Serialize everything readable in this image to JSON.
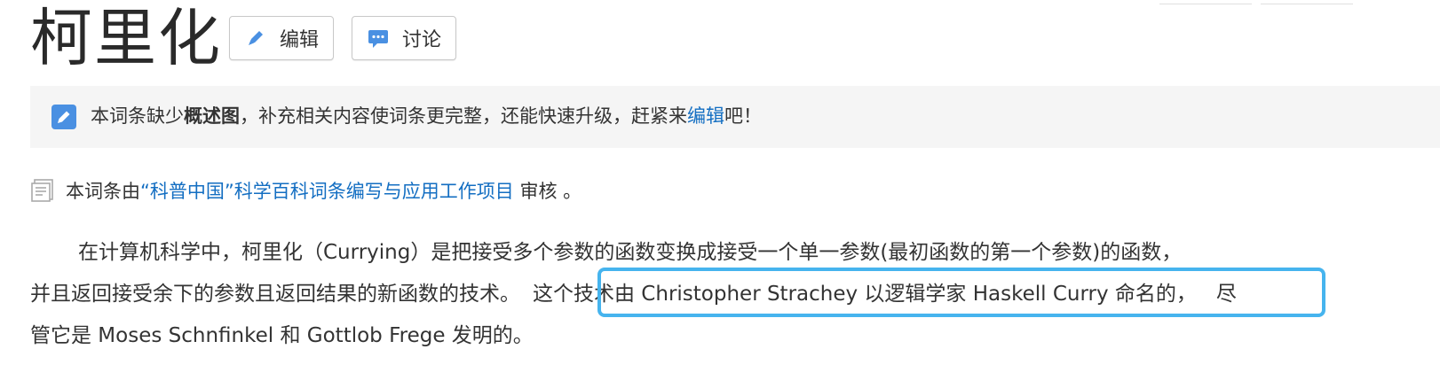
{
  "article": {
    "title": "柯里化",
    "edit_label": "编辑",
    "discuss_label": "讨论"
  },
  "notice": {
    "prefix": "本词条缺少",
    "bold": "概述图",
    "middle": "，补充相关内容使词条更完整，还能快速升级，赶紧来",
    "link": "编辑",
    "suffix": "吧！"
  },
  "review": {
    "prefix": "本词条由",
    "link": "“科普中国”科学百科词条编写与应用工作项目",
    "suffix": " 审核 。"
  },
  "paragraph": {
    "line1": "在计算机科学中，柯里化（Currying）是把接受多个参数的函数变换成接受一个单一参数(最初函数的第一个参数)的函数，",
    "line2a": "并且返回接受余下的参数且返回结果的新函数的技术。",
    "line2b": "这个技术由 Christopher Strachey 以逻辑学家 Haskell Curry 命名的，",
    "line2c": "尽",
    "line3": "管它是 Moses Schnfinkel 和 Gottlob Frege 发明的。"
  },
  "icons": {
    "edit": "pencil-icon",
    "discuss": "chat-bubble-icon",
    "notice": "pencil-badge-icon",
    "review": "document-icon"
  },
  "colors": {
    "link": "#136ec2",
    "highlight": "#46b4ee",
    "icon_blue": "#4a90e2"
  }
}
